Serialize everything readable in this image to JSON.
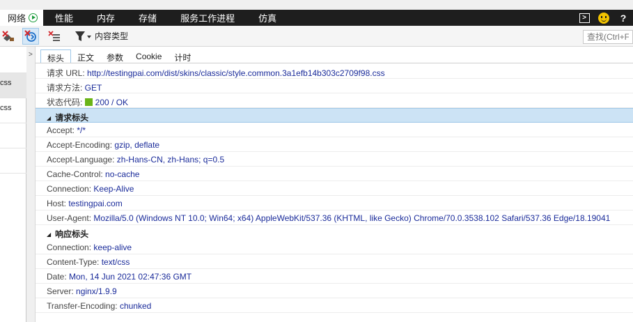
{
  "tabs": [
    {
      "label": "网络",
      "active": true
    },
    {
      "label": "性能"
    },
    {
      "label": "内存"
    },
    {
      "label": "存储"
    },
    {
      "label": "服务工作进程"
    },
    {
      "label": "仿真"
    }
  ],
  "topbar_right": {
    "help": "?"
  },
  "toolbar": {
    "filter_label": "内容类型",
    "search_placeholder": "查找(Ctrl+F)"
  },
  "request_list": [
    {
      "name": "css",
      "selected": true
    },
    {
      "name": "css"
    },
    {
      "name": ""
    },
    {
      "name": ""
    }
  ],
  "detail_tabs": [
    "标头",
    "正文",
    "参数",
    "Cookie",
    "计时"
  ],
  "general": [
    {
      "key": "请求 URL: ",
      "value": "http://testingpai.com/dist/skins/classic/style.common.3a1efb14b303c2709f98.css"
    },
    {
      "key": "请求方法: ",
      "value": "GET"
    },
    {
      "key": "状态代码: ",
      "value": "200 / OK",
      "status_color": "#6ab417"
    }
  ],
  "request_headers_title": "请求标头",
  "request_headers": [
    {
      "key": "Accept: ",
      "value": "*/*"
    },
    {
      "key": "Accept-Encoding: ",
      "value": "gzip, deflate"
    },
    {
      "key": "Accept-Language: ",
      "value": "zh-Hans-CN, zh-Hans; q=0.5"
    },
    {
      "key": "Cache-Control: ",
      "value": "no-cache"
    },
    {
      "key": "Connection: ",
      "value": "Keep-Alive"
    },
    {
      "key": "Host: ",
      "value": "testingpai.com"
    },
    {
      "key": "User-Agent: ",
      "value": "Mozilla/5.0 (Windows NT 10.0; Win64; x64) AppleWebKit/537.36 (KHTML, like Gecko) Chrome/70.0.3538.102 Safari/537.36 Edge/18.19041"
    }
  ],
  "response_headers_title": "响应标头",
  "response_headers": [
    {
      "key": "Connection: ",
      "value": "keep-alive"
    },
    {
      "key": "Content-Type: ",
      "value": "text/css"
    },
    {
      "key": "Date: ",
      "value": "Mon, 14 Jun 2021 02:47:36 GMT"
    },
    {
      "key": "Server: ",
      "value": "nginx/1.9.9"
    },
    {
      "key": "Transfer-Encoding: ",
      "value": "chunked"
    }
  ],
  "colors": {
    "accent": "#9ec7e8",
    "section_highlight": "#cce3f5",
    "value_text": "#1a2b9a"
  }
}
